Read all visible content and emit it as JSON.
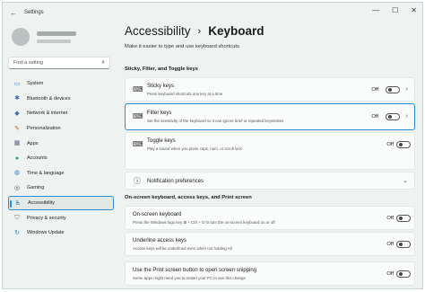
{
  "window": {
    "title": "Settings",
    "back_icon": "back-arrow-icon",
    "controls": [
      "minimize-icon",
      "maximize-icon",
      "close-icon"
    ]
  },
  "sidebar": {
    "search_placeholder": "Find a setting",
    "items": [
      {
        "label": "System",
        "icon": "monitor-icon"
      },
      {
        "label": "Bluetooth & devices",
        "icon": "bluetooth-icon"
      },
      {
        "label": "Network & internet",
        "icon": "wifi-icon"
      },
      {
        "label": "Personalization",
        "icon": "brush-icon"
      },
      {
        "label": "Apps",
        "icon": "apps-icon"
      },
      {
        "label": "Accounts",
        "icon": "person-icon"
      },
      {
        "label": "Time & language",
        "icon": "globe-clock-icon"
      },
      {
        "label": "Gaming",
        "icon": "gamepad-icon"
      },
      {
        "label": "Accessibility",
        "icon": "accessibility-icon",
        "active": true
      },
      {
        "label": "Privacy & security",
        "icon": "shield-icon"
      },
      {
        "label": "Windows Update",
        "icon": "update-icon"
      }
    ]
  },
  "main": {
    "breadcrumb_parent": "Accessibility",
    "breadcrumb_current": "Keyboard",
    "subtitle": "Make it easier to type and use keyboard shortcuts.",
    "section1_title": "Sticky, Filter, and Toggle keys",
    "section2_title": "On-screen keyboard, access keys, and Print screen",
    "cards": [
      {
        "title": "Sticky keys",
        "desc": "Press keyboard shortcuts one key at a time",
        "state": "Off",
        "icon": "sticky-keys-icon",
        "chevron": true
      },
      {
        "title": "Filter keys",
        "desc": "Set the sensitivity of the keyboard so it can ignore brief or repeated keystrokes",
        "state": "Off",
        "icon": "filter-keys-icon",
        "chevron": true
      },
      {
        "title": "Toggle keys",
        "desc": "Play a sound when you press caps, num, or scroll lock",
        "state": "Off",
        "icon": "toggle-keys-icon"
      },
      {
        "title": "Notification preferences",
        "icon": "info-icon",
        "chevron_down": true
      },
      {
        "title": "On-screen keyboard",
        "desc": "Press the Windows logo key ⊞ + Ctrl + O to turn the on-screen keyboard on or off",
        "state": "Off"
      },
      {
        "title": "Underline access keys",
        "desc": "Access keys will be underlined even when not holding Alt",
        "state": "Off"
      },
      {
        "title": "Use the Print screen button to open screen snipping",
        "desc": "Some apps might need you to restart your PC to see this change",
        "state": "Off"
      }
    ]
  },
  "colors": {
    "accent": "#2a8fd4",
    "window_bg": "#eef3f1",
    "card_bg": "#fafbfb"
  }
}
